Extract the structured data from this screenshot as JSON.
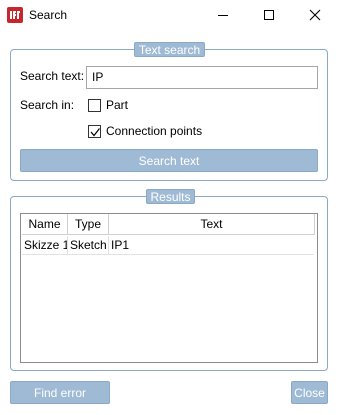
{
  "window": {
    "title": "Search"
  },
  "text_search": {
    "group_title": "Text search",
    "search_text_label": "Search text:",
    "search_text_value": "IP",
    "search_in_label": "Search in:",
    "options": [
      {
        "label": "Part",
        "checked": false
      },
      {
        "label": "Connection points",
        "checked": true
      }
    ],
    "search_button": "Search text"
  },
  "results": {
    "group_title": "Results",
    "columns": [
      "Name",
      "Type",
      "Text"
    ],
    "rows": [
      {
        "name": "Skizze 1",
        "type": "Sketch",
        "text": "IP1"
      }
    ]
  },
  "footer": {
    "find_error_button": "Find error",
    "close_button": "Close"
  },
  "colors": {
    "accent": "#9fbad4",
    "border": "#8aa9c6",
    "app_icon": "#c8262d"
  }
}
